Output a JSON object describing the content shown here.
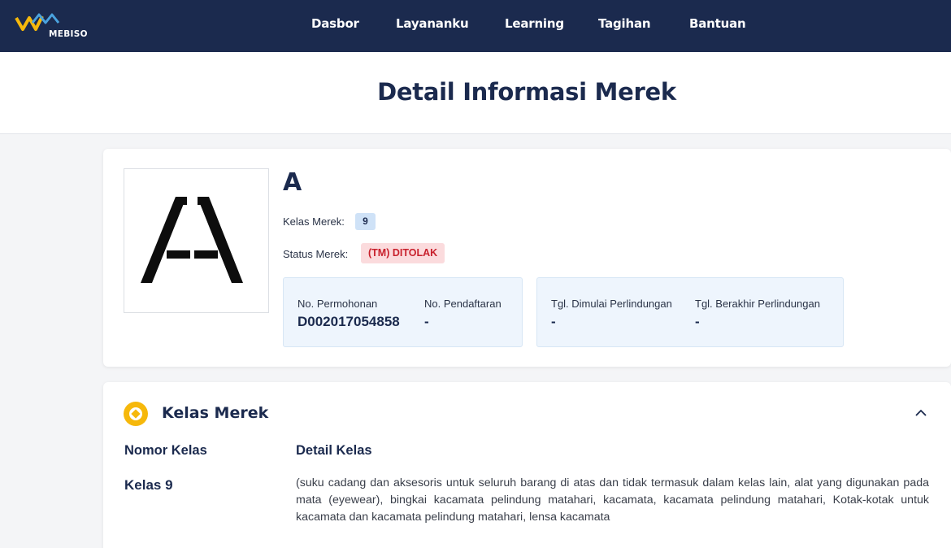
{
  "navbar": {
    "logo_text": "MEBISO",
    "items": [
      "Dasbor",
      "Layananku",
      "Learning",
      "Tagihan",
      "Bantuan"
    ]
  },
  "page": {
    "title": "Detail Informasi Merek"
  },
  "mark": {
    "name": "A",
    "class_label": "Kelas Merek:",
    "class_value": "9",
    "status_label": "Status Merek:",
    "status_value": "(TM) DITOLAK",
    "application_no_label": "No. Permohonan",
    "application_no": "D002017054858",
    "registration_no_label": "No. Pendaftaran",
    "registration_no": "-",
    "protection_start_label": "Tgl. Dimulai Perlindungan",
    "protection_start": "-",
    "protection_end_label": "Tgl. Berakhir Perlindungan",
    "protection_end": "-"
  },
  "class_section": {
    "title": "Kelas Merek",
    "col_number": "Nomor Kelas",
    "col_detail": "Detail Kelas",
    "rows": [
      {
        "number": "Kelas 9",
        "detail": "(suku cadang dan aksesoris untuk seluruh barang di atas dan tidak termasuk dalam kelas lain, alat yang digunakan pada mata (eyewear), bingkai kacamata pelindung matahari, kacamata, kacamata pelindung matahari, Kotak-kotak untuk kacamata dan kacamata pelindung matahari, lensa kacamata"
      }
    ]
  },
  "colors": {
    "navbar": "#1b2a4e",
    "accent": "#f6b80b",
    "status_bg": "#fbdbdd",
    "status_text": "#c8202c",
    "info_box": "#eef5fd"
  }
}
